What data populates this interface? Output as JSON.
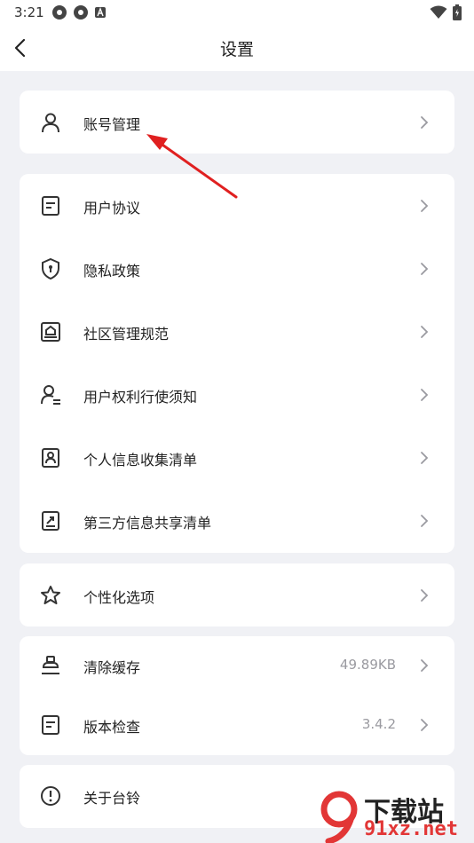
{
  "status": {
    "time": "3:21"
  },
  "header": {
    "title": "设置"
  },
  "groups": [
    {
      "items": [
        {
          "label": "账号管理",
          "icon": "user-icon"
        }
      ]
    },
    {
      "items": [
        {
          "label": "用户协议",
          "icon": "document-icon"
        },
        {
          "label": "隐私政策",
          "icon": "shield-icon"
        },
        {
          "label": "社区管理规范",
          "icon": "community-icon"
        },
        {
          "label": "用户权利行使须知",
          "icon": "user-rights-icon"
        },
        {
          "label": "个人信息收集清单",
          "icon": "id-card-icon"
        },
        {
          "label": "第三方信息共享清单",
          "icon": "share-icon"
        }
      ]
    },
    {
      "items": [
        {
          "label": "个性化选项",
          "icon": "star-icon"
        }
      ]
    },
    {
      "items": [
        {
          "label": "清除缓存",
          "icon": "broom-icon",
          "value": "49.89KB"
        },
        {
          "label": "版本检查",
          "icon": "version-icon",
          "value": "3.4.2"
        }
      ]
    },
    {
      "items": [
        {
          "label": "关于台铃",
          "icon": "info-icon"
        }
      ]
    }
  ],
  "watermark": {
    "text": "下载站",
    "domain": "91xz.net"
  },
  "colors": {
    "background": "#f0f1f5",
    "card": "#ffffff",
    "annotation_arrow": "#e02020",
    "secondary_text": "#9a9aa0"
  }
}
